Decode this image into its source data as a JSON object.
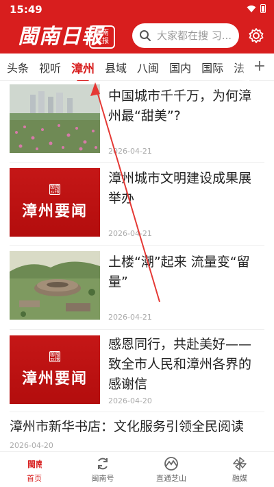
{
  "status_bar": {
    "time": "15:49"
  },
  "header": {
    "logo_text": "閩南日報",
    "seal_text": "閩南\n云报",
    "search": {
      "placeholder": "大家都在搜 习..."
    }
  },
  "tabs": [
    "头条",
    "视听",
    "漳州",
    "县域",
    "八闽",
    "国内",
    "国际",
    "法"
  ],
  "active_tab": "漳州",
  "news": [
    {
      "title": "中国城市千千万，为何漳州最“甜美”?",
      "date": "2026-04-21",
      "thumb": "garden-photo"
    },
    {
      "title": "漳州城市文明建设成果展举办",
      "date": "2026-04-21",
      "thumb": "red",
      "thumb_text": "漳州要闻",
      "thumb_seal": "閩南云报"
    },
    {
      "title": "土楼“潮”起来 流量变“留量”",
      "date": "2026-04-21",
      "thumb": "tulou-photo"
    },
    {
      "title": "感恩同行，共赴美好——致全市人民和漳州各界的感谢信",
      "date": "2026-04-20",
      "thumb": "red",
      "thumb_text": "漳州要闻",
      "thumb_seal": "閩南云报"
    }
  ],
  "text_news": {
    "title": "漳州市新华书店：文化服务引领全民阅读",
    "date": "2026-04-20"
  },
  "bottom_nav": [
    {
      "label": "首页",
      "icon": "home-logo-icon",
      "active": true
    },
    {
      "label": "闽南号",
      "icon": "refresh-circle-icon"
    },
    {
      "label": "直通芝山",
      "icon": "mountain-icon"
    },
    {
      "label": "融媒",
      "icon": "pinwheel-icon"
    }
  ],
  "colors": {
    "brand": "#d81e1e",
    "annotation": "#e53935"
  }
}
